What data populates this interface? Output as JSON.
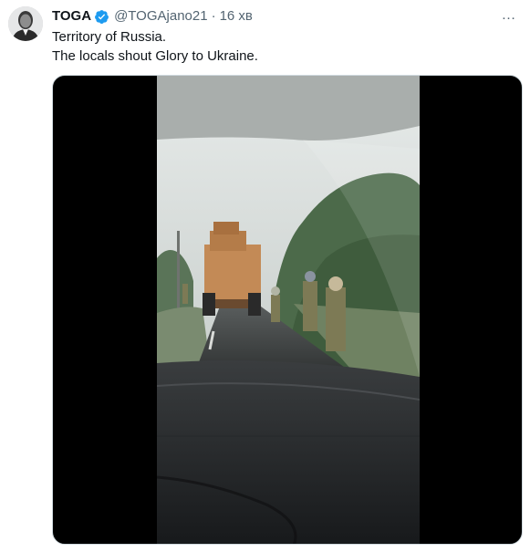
{
  "tweet": {
    "author": {
      "display_name": "TOGA",
      "verified": true,
      "handle": "@TOGAjano21",
      "separator": "·",
      "time_ago": "16 хв"
    },
    "text_lines": [
      "Territory of Russia.",
      "The locals shout Glory to Ukraine."
    ],
    "more_icon": "…",
    "media": {
      "type": "video"
    }
  },
  "colors": {
    "accent": "#1d9bf0",
    "secondary_text": "#536471",
    "primary_text": "#0f1419",
    "media_border": "#cfd9de"
  },
  "icons": {
    "verified": "verified-badge-icon",
    "more": "more-options-icon"
  }
}
